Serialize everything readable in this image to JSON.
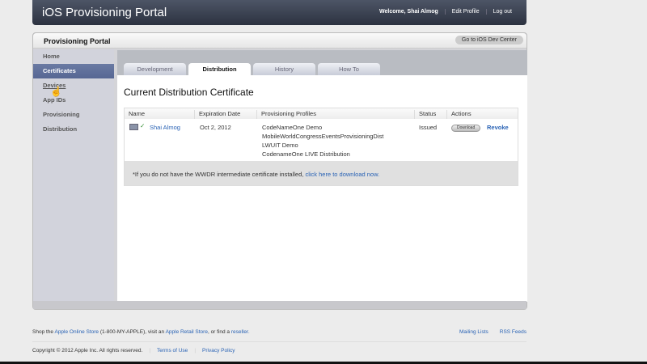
{
  "header": {
    "title": "iOS Provisioning Portal",
    "welcome": "Welcome, Shai Almog",
    "edit_profile": "Edit Profile",
    "logout": "Log out"
  },
  "panel": {
    "title": "Provisioning Portal",
    "dev_center": "Go to iOS Dev Center"
  },
  "sidebar": {
    "items": [
      {
        "label": "Home"
      },
      {
        "label": "Certificates",
        "active": true
      },
      {
        "label": "Devices"
      },
      {
        "label": "App IDs"
      },
      {
        "label": "Provisioning"
      },
      {
        "label": "Distribution"
      }
    ]
  },
  "tabs": [
    {
      "label": "Development"
    },
    {
      "label": "Distribution",
      "active": true
    },
    {
      "label": "History"
    },
    {
      "label": "How To"
    }
  ],
  "content": {
    "heading": "Current Distribution Certificate",
    "columns": [
      "Name",
      "Expiration Date",
      "Provisioning Profiles",
      "Status",
      "Actions"
    ],
    "row": {
      "name": "Shai Almog",
      "expiration": "Oct 2, 2012",
      "profiles": [
        "CodeNameOne Demo",
        "MobileWorldCongressEventsProvisioningDist",
        "LWUIT Demo",
        "CodenameOne LIVE Distribution"
      ],
      "status": "Issued",
      "download": "Download",
      "revoke": "Revoke"
    },
    "note": "*If you do not have the WWDR intermediate certificate installed,",
    "note_link": "click here to download now."
  },
  "footer": {
    "shop_prefix": "Shop the",
    "online_store": "Apple Online Store",
    "phone": "(1-800-MY-APPLE), visit an",
    "retail_store": "Apple Retail Store",
    "find": ", or find a",
    "reseller": "reseller.",
    "mailing": "Mailing Lists",
    "rss": "RSS Feeds",
    "copyright": "Copyright © 2012 Apple Inc. All rights reserved.",
    "terms": "Terms of Use",
    "privacy": "Privacy Policy"
  }
}
